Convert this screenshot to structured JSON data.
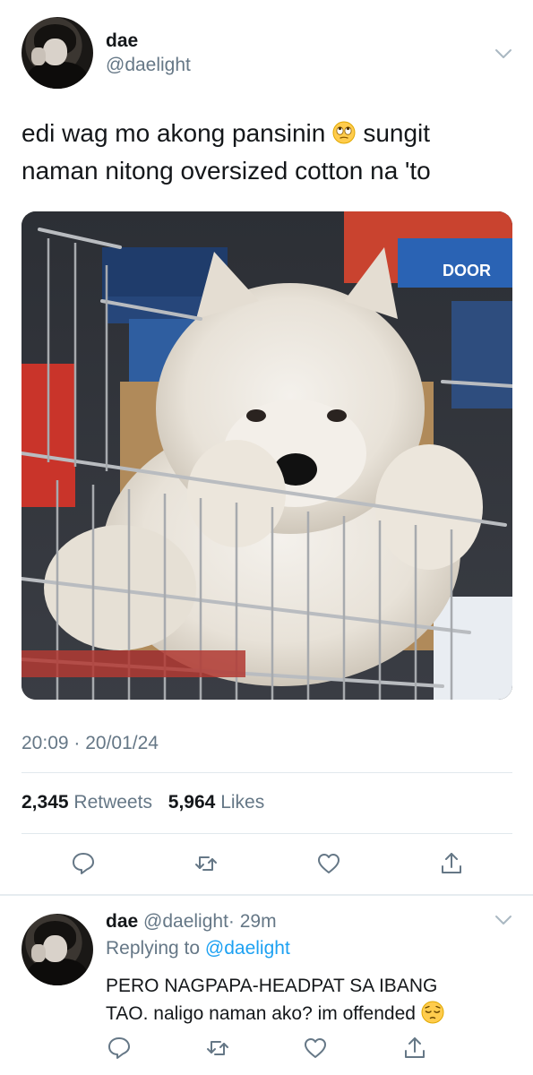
{
  "tweet": {
    "display_name": "dae",
    "handle": "@daelight",
    "text_line1": "edi wag mo akong pansinin",
    "text_line1_emoji": "face-with-rolling-eyes-emoji",
    "text_line1_after": "sungit",
    "text_line2": "naman nitong oversized cotton na 'to",
    "image": "fluffy white puppy in shopping cart",
    "timestamp": "20:09 · 20/01/24",
    "retweets_count": "2,345",
    "retweets_label": "Retweets",
    "likes_count": "5,964",
    "likes_label": "Likes",
    "actions": [
      "reply-icon",
      "retweet-icon",
      "like-icon",
      "share-icon"
    ]
  },
  "reply": {
    "display_name": "dae",
    "handle": "@daelight",
    "time": "· 29m",
    "replying_prefix": "Replying to",
    "replying_to": "@daelight",
    "text_line1": "PERO NAGPAPA-HEADPAT SA IBANG",
    "text_line2": "TAO. naligo naman ako? im offended",
    "text_emoji": "pensive-face-emoji",
    "actions": [
      "reply-icon",
      "retweet-icon",
      "like-icon",
      "share-icon"
    ]
  },
  "colors": {
    "text_primary": "#14171a",
    "text_secondary": "#657786",
    "link": "#1da1f2",
    "divider": "#e1e8ed"
  }
}
